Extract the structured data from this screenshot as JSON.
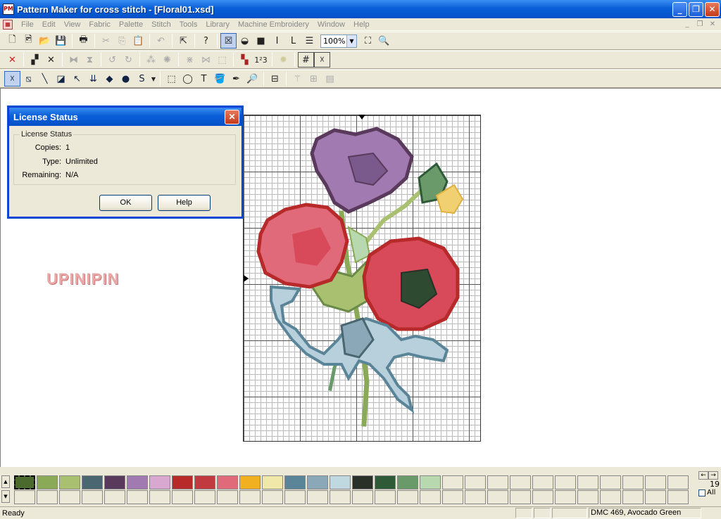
{
  "window": {
    "title": "Pattern Maker for cross stitch - [Floral01.xsd]",
    "icon_text": "PM",
    "min": "_",
    "max": "❐",
    "close": "✕"
  },
  "menu": [
    "File",
    "Edit",
    "View",
    "Fabric",
    "Palette",
    "Stitch",
    "Tools",
    "Library",
    "Machine Embroidery",
    "Window",
    "Help"
  ],
  "zoom": {
    "value": "100%"
  },
  "dialog": {
    "title": "License Status",
    "group": "License Status",
    "fields": [
      {
        "label": "Copies:",
        "value": "1"
      },
      {
        "label": "Type:",
        "value": "Unlimited"
      },
      {
        "label": "Remaining:",
        "value": "N/A"
      }
    ],
    "ok": "OK",
    "help": "Help"
  },
  "watermark": "UPINIPIN",
  "palette": {
    "count": "19",
    "all_label": "All",
    "colors": [
      "#4a6a2e",
      "#8aaa58",
      "#a8c070",
      "#4a6670",
      "#5a3a5c",
      "#a07ab0",
      "#d8a8d0",
      "#b82a2a",
      "#c03a40",
      "#e06a7a",
      "#f0b020",
      "#f0e8a8",
      "#5a8498",
      "#8aa8b8",
      "#c0d8e0",
      "#283028",
      "#2e5a38",
      "#6a9a6a",
      "#b8d8b0"
    ]
  },
  "status": {
    "ready": "Ready",
    "color_info": "DMC  469, Avocado Green"
  }
}
